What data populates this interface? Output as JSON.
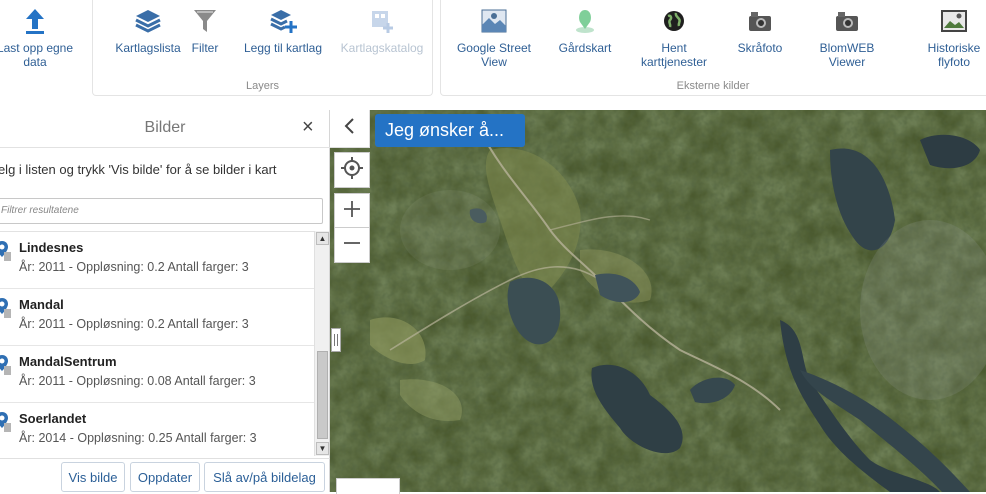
{
  "ribbon": {
    "upload": {
      "label_line1": "Last opp egne",
      "label_line2": "data"
    },
    "layers": {
      "group_label": "Layers",
      "kartlagslista": "Kartlagslista",
      "filter": "Filter",
      "legg_til": "Legg til kartlag",
      "katalog": "Kartlagskatalog"
    },
    "external": {
      "group_label": "Eksterne kilder",
      "street_view_line1": "Google Street",
      "street_view_line2": "View",
      "gardskart": "Gårdskart",
      "hent_line1": "Hent",
      "hent_line2": "karttjenester",
      "skrafoto": "Skråfoto",
      "blom_line1": "BlomWEB",
      "blom_line2": "Viewer",
      "hist_line1": "Historiske",
      "hist_line2": "flyfoto"
    }
  },
  "panel": {
    "title": "Bilder",
    "close": "×",
    "hint": "Velg i listen og trykk 'Vis bilde' for å se bilder i kart",
    "filter_placeholder": "Filtrer resultatene",
    "items": [
      {
        "name": "Lindesnes",
        "meta": "År: 2011 - Oppløsning: 0.2 Antall farger: 3"
      },
      {
        "name": "Mandal",
        "meta": "År: 2011 - Oppløsning: 0.2 Antall farger: 3"
      },
      {
        "name": "MandalSentrum",
        "meta": "År: 2011 - Oppløsning: 0.08 Antall farger: 3"
      },
      {
        "name": "Soerlandet",
        "meta": "År: 2014 - Oppløsning: 0.25 Antall farger: 3"
      }
    ],
    "buttons": {
      "vis": "Vis bilde",
      "oppdater": "Oppdater",
      "sla": "Slå av/på bildelag"
    }
  },
  "map": {
    "jeg_onsker": "Jeg ønsker å..."
  },
  "colors": {
    "accent": "#2473c5",
    "link": "#2f5f95"
  }
}
